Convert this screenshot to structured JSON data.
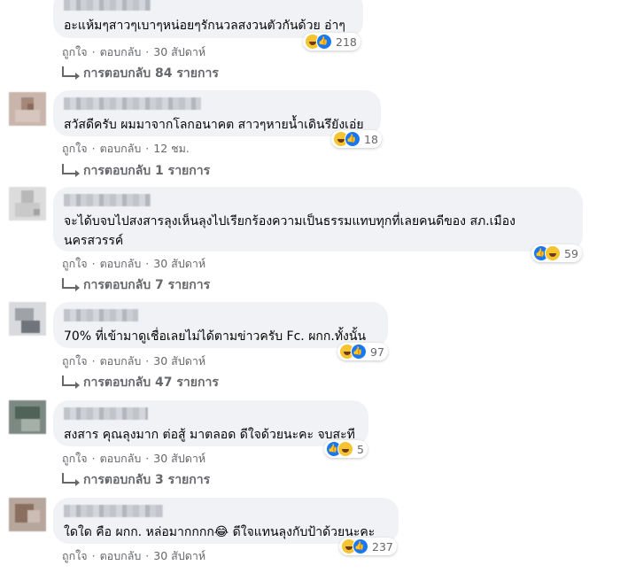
{
  "comments": [
    {
      "text": "อะแห้มๆสาวๆเบาๆหน่อยๆรักนวลสงวนตัวกันด้วย อ่าๆ",
      "reactions": {
        "icons": [
          "haha-icon",
          "like-icon"
        ],
        "count": "218"
      },
      "like_label": "ถูกใจ",
      "reply_label": "ตอบกลับ",
      "time": "30 สัปดาห์",
      "replies_label": "การตอบกลับ 84 รายการ"
    },
    {
      "text": "สวัสดีครับ ผมมาจากโลกอนาคต สาวๆหายน้ำเดินรึยังเอ่ย",
      "reactions": {
        "icons": [
          "haha-icon",
          "like-icon"
        ],
        "count": "18"
      },
      "like_label": "ถูกใจ",
      "reply_label": "ตอบกลับ",
      "time": "12 ชม.",
      "replies_label": "การตอบกลับ 1 รายการ"
    },
    {
      "text": "จะได้บจบไปสงสารลุงเห็นลุงไปเรียกร้องความเป็นธรรมแทบทุกที่เลยคนดีของ สภ.เมือง นครสวรรค์",
      "reactions": {
        "icons": [
          "like-icon",
          "haha-icon"
        ],
        "count": "59"
      },
      "like_label": "ถูกใจ",
      "reply_label": "ตอบกลับ",
      "time": "30 สัปดาห์",
      "replies_label": "การตอบกลับ 7 รายการ"
    },
    {
      "text": "70% ที่เข้ามาดูเชื่อเลยไม่ได้ตามข่าวครับ Fc. ผกก.ทั้งนั้น",
      "reactions": {
        "icons": [
          "haha-icon",
          "like-icon"
        ],
        "count": "97"
      },
      "like_label": "ถูกใจ",
      "reply_label": "ตอบกลับ",
      "time": "30 สัปดาห์",
      "replies_label": "การตอบกลับ 47 รายการ"
    },
    {
      "text": "สงสาร คุณลุงมาก ต่อสู้ มาตลอด ดีใจด้วยนะคะ จบสะที",
      "reactions": {
        "icons": [
          "like-icon",
          "haha-icon"
        ],
        "count": "5"
      },
      "like_label": "ถูกใจ",
      "reply_label": "ตอบกลับ",
      "time": "30 สัปดาห์",
      "replies_label": "การตอบกลับ 3 รายการ"
    },
    {
      "text": "ใดใด คือ ผกก. หล่อมากกกก😂 ดีใจแทนลุงกับป้าด้วยนะคะ",
      "reactions": {
        "icons": [
          "haha-icon",
          "like-icon"
        ],
        "count": "237"
      },
      "like_label": "ถูกใจ",
      "reply_label": "ตอบกลับ",
      "time": "30 สัปดาห์"
    }
  ],
  "colors": {
    "bubble": "#f0f2f5",
    "meta_text": "#65676b",
    "like_blue": "#1877f2",
    "haha_yellow": "#f7c431"
  }
}
